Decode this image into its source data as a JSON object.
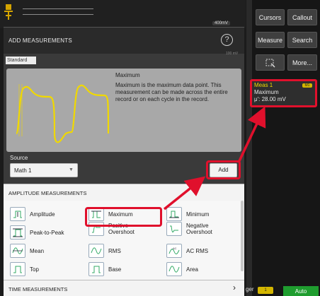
{
  "scope": {
    "scale_badge": "400mV",
    "tiny_readout": "100 mV"
  },
  "right_panel": {
    "buttons": [
      {
        "label": "Cursors"
      },
      {
        "label": "Callout"
      },
      {
        "label": "Measure"
      },
      {
        "label": "Search"
      },
      {
        "label": "⚃"
      },
      {
        "label": "More..."
      }
    ],
    "meas_badge": {
      "title": "Meas 1",
      "tag": "M1",
      "name": "Maximum",
      "value": "μ': 28.00 mV"
    },
    "trigger_label": "ger",
    "trigger_value": "1",
    "run_mode": "Auto"
  },
  "dialog": {
    "title": "ADD MEASUREMENTS",
    "help_icon": "?",
    "standard_tab": "Standard",
    "info": {
      "title": "Maximum",
      "description": "Maximum is the maximum data point. This measurement can be made across the entire record or on each cycle in the record."
    },
    "source": {
      "label": "Source",
      "value": "Math 1"
    },
    "add_label": "Add",
    "amplitude_header": "AMPLITUDE MEASUREMENTS",
    "measurements": [
      {
        "label": "Amplitude",
        "icon": "amplitude-icon"
      },
      {
        "label": "Maximum",
        "icon": "maximum-icon"
      },
      {
        "label": "Minimum",
        "icon": "minimum-icon"
      },
      {
        "label": "Peak-to-Peak",
        "icon": "peak-to-peak-icon"
      },
      {
        "label": "Positive Overshoot",
        "icon": "positive-overshoot-icon"
      },
      {
        "label": "Negative Overshoot",
        "icon": "negative-overshoot-icon"
      },
      {
        "label": "Mean",
        "icon": "mean-icon"
      },
      {
        "label": "RMS",
        "icon": "rms-icon"
      },
      {
        "label": "AC RMS",
        "icon": "ac-rms-icon"
      },
      {
        "label": "Top",
        "icon": "top-icon"
      },
      {
        "label": "Base",
        "icon": "base-icon"
      },
      {
        "label": "Area",
        "icon": "area-icon"
      }
    ],
    "time_header": "TIME MEASUREMENTS",
    "time_chevron": "›"
  },
  "colors": {
    "highlight": "#e0102c",
    "waveform": "#f0d800",
    "badge_title": "#f1d800",
    "auto_green": "#1f9d2f"
  }
}
